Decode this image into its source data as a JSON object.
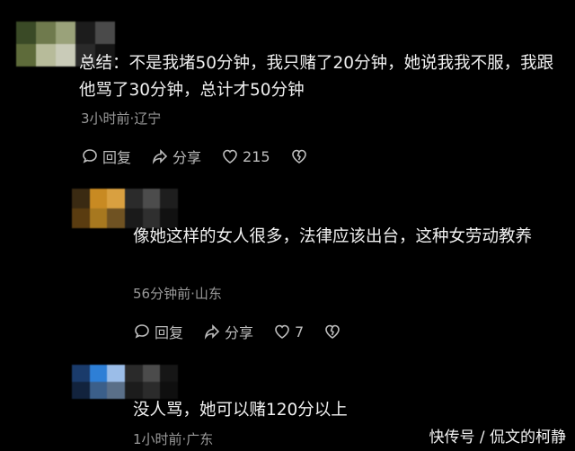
{
  "comments": [
    {
      "text": "总结：不是我堵50分钟，我只赌了20分钟，她说我我不服，我跟他骂了30分钟，总计才50分钟",
      "meta": "3小时前·辽宁",
      "reply_label": "回复",
      "share_label": "分享",
      "like_count": "215"
    },
    {
      "text": "像她这样的女人很多，法律应该出台，这种女劳动教养",
      "meta": "56分钟前·山东",
      "reply_label": "回复",
      "share_label": "分享",
      "like_count": "7"
    },
    {
      "text": "没人骂，她可以赌120分以上",
      "meta": "1小时前·广东"
    }
  ],
  "avatars": {
    "c1": [
      "#3a4a26",
      "#6f7a4d",
      "#9aa27a",
      "#1c1c1c",
      "#4a4a4a",
      "#5e6b3a",
      "#b7bb9a",
      "#c9cbb8",
      "#2a2a2a",
      "#151515"
    ],
    "c2": [
      "#3a2a12",
      "#c88a22",
      "#d9a040",
      "#2b2b2b",
      "#4c4c4c",
      "#1e1e1e",
      "#5a3c10",
      "#a7781f",
      "#6f5222",
      "#1a1a1a",
      "#2f2f2f",
      "#111111"
    ],
    "c3": [
      "#1a3b6b",
      "#2e7fd6",
      "#9bbde8",
      "#2a2a2a",
      "#4b4b4b",
      "#161616",
      "#12233d",
      "#3b5f8a",
      "#5a6f88",
      "#1c1c1c",
      "#2b2b2b",
      "#0f0f0f"
    ]
  },
  "watermark": "快传号 / 侃文的柯静",
  "colors": {
    "background": "#000000",
    "text": "#f0f0f0",
    "meta": "#9a9a9a",
    "icons": "#bdbdbd"
  }
}
